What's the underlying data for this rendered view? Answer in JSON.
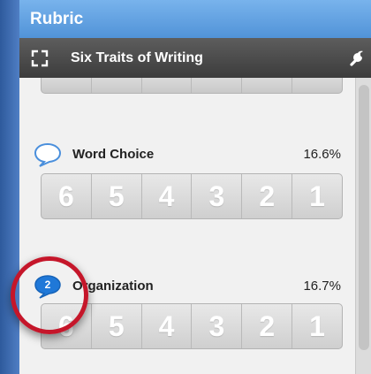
{
  "panel": {
    "title": "Rubric"
  },
  "toolbar": {
    "title": "Six Traits of Writing"
  },
  "traits": [
    {
      "name": "Word Choice",
      "percent": "16.6%",
      "comment_count": "",
      "scores": [
        "6",
        "5",
        "4",
        "3",
        "2",
        "1"
      ]
    },
    {
      "name": "Organization",
      "percent": "16.7%",
      "comment_count": "2",
      "scores": [
        "6",
        "5",
        "4",
        "3",
        "2",
        "1"
      ]
    }
  ],
  "colors": {
    "title_bar": "#5a9ae0",
    "toolbar": "#4a4a4a",
    "comment_icon": "#1f78d8",
    "highlight_circle": "#c5162a"
  },
  "icons": {
    "expand": "expand-arrows-icon",
    "settings": "wrench-icon",
    "comment": "comment-bubble-icon"
  }
}
